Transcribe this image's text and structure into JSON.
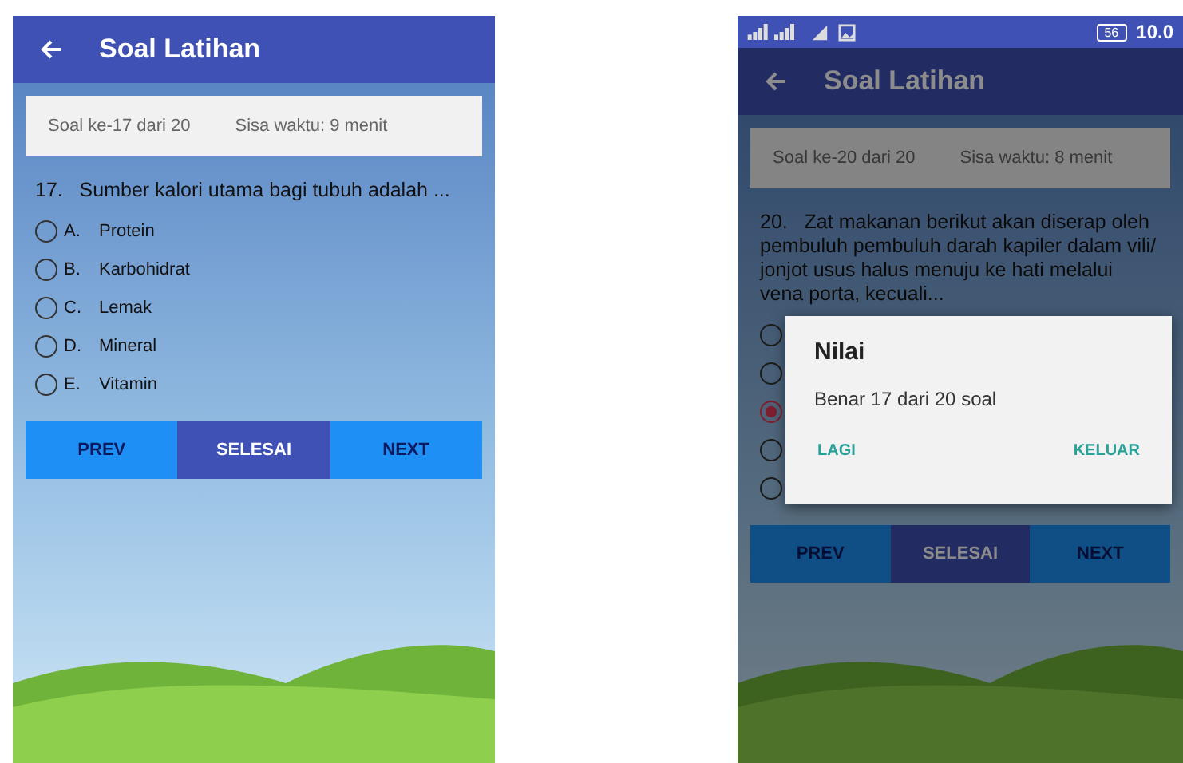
{
  "screens": [
    {
      "app_bar": {
        "title": "Soal Latihan"
      },
      "info": {
        "progress": "Soal ke-17 dari 20",
        "timer": "Sisa waktu: 9 menit"
      },
      "question": {
        "number": "17.",
        "text": "Sumber kalori utama bagi tubuh adalah ..."
      },
      "options": [
        {
          "letter": "A.",
          "text": "Protein",
          "selected": false
        },
        {
          "letter": "B.",
          "text": "Karbohidrat",
          "selected": false
        },
        {
          "letter": "C.",
          "text": "Lemak",
          "selected": false
        },
        {
          "letter": "D.",
          "text": "Mineral",
          "selected": false
        },
        {
          "letter": "E.",
          "text": "Vitamin",
          "selected": false
        }
      ],
      "buttons": [
        {
          "label": "PREV",
          "kind": "nav"
        },
        {
          "label": "SELESAI",
          "kind": "finish"
        },
        {
          "label": "NEXT",
          "kind": "nav"
        }
      ]
    },
    {
      "status_bar": {
        "battery": "56",
        "time": "10.0"
      },
      "app_bar": {
        "title": "Soal Latihan"
      },
      "info": {
        "progress": "Soal ke-20 dari 20",
        "timer": "Sisa waktu: 8 menit"
      },
      "question": {
        "number": "20.",
        "text": "Zat makanan berikut akan diserap oleh pembuluh pembuluh darah kapiler dalam vili/ jonjot usus halus menuju ke hati melalui vena porta, kecuali..."
      },
      "options": [
        {
          "selected": false
        },
        {
          "selected": false
        },
        {
          "selected": true
        },
        {
          "selected": false
        },
        {
          "selected": false
        }
      ],
      "buttons": [
        {
          "label": "PREV",
          "kind": "nav"
        },
        {
          "label": "SELESAI",
          "kind": "finish"
        },
        {
          "label": "NEXT",
          "kind": "nav"
        }
      ],
      "dialog": {
        "title": "Nilai",
        "message": "Benar 17 dari 20 soal",
        "buttons": [
          "LAGI",
          "KELUAR"
        ]
      }
    }
  ]
}
